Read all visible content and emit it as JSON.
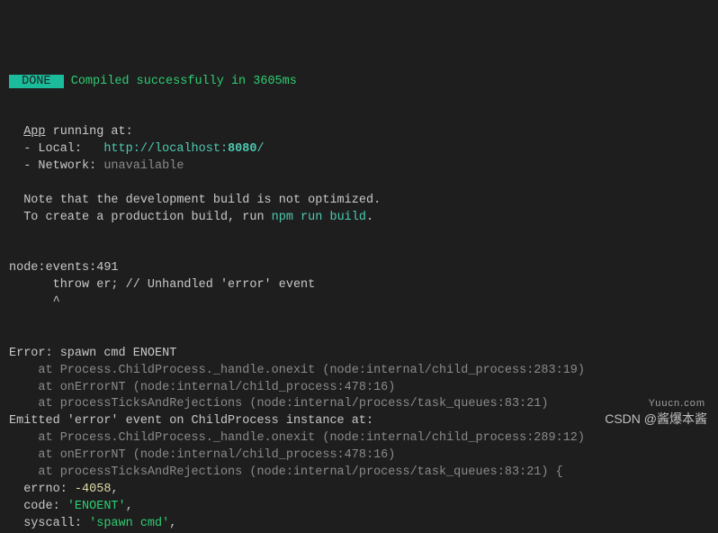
{
  "badge": " DONE ",
  "compiled": "Compiled successfully in 3605ms",
  "appRunning": "App",
  "runningAt": " running at:",
  "localLabel": "  - Local:   ",
  "localUrlPrefix": "http://localhost:",
  "localPort": "8080",
  "localUrlSuffix": "/",
  "networkLabel": "  - Network: ",
  "networkValue": "unavailable",
  "noteLine1": "  Note that the development build is not optimized.",
  "noteLine2a": "  To create a production build, run ",
  "npmRunBuild": "npm run build",
  "noteLine2b": ".",
  "eventsLine": "node:events:491",
  "throwLine": "      throw er; // Unhandled 'error' event",
  "caretLine": "      ^",
  "errorTitle": "Error: spawn cmd ENOENT",
  "stack1": "    at Process.ChildProcess._handle.onexit (node:internal/child_process:283:19)",
  "stack2": "    at onErrorNT (node:internal/child_process:478:16)",
  "stack3": "    at processTicksAndRejections (node:internal/process/task_queues:83:21)",
  "emittedTitle": "Emitted 'error' event on ChildProcess instance at:",
  "stack4": "    at Process.ChildProcess._handle.onexit (node:internal/child_process:289:12)",
  "stack5": "    at onErrorNT (node:internal/child_process:478:16)",
  "stack6": "    at processTicksAndRejections (node:internal/process/task_queues:83:21) {",
  "errnoLabel": "  errno: ",
  "errnoValue": "-4058",
  "errnoComma": ",",
  "codeLabel": "  code: ",
  "codeValue": "'ENOENT'",
  "codeComma": ",",
  "syscallLabel": "  syscall: ",
  "syscallValue": "'spawn cmd'",
  "syscallComma": ",",
  "watermarkLogo": "Yuucn.com",
  "watermarkText": "CSDN @酱爆本酱"
}
